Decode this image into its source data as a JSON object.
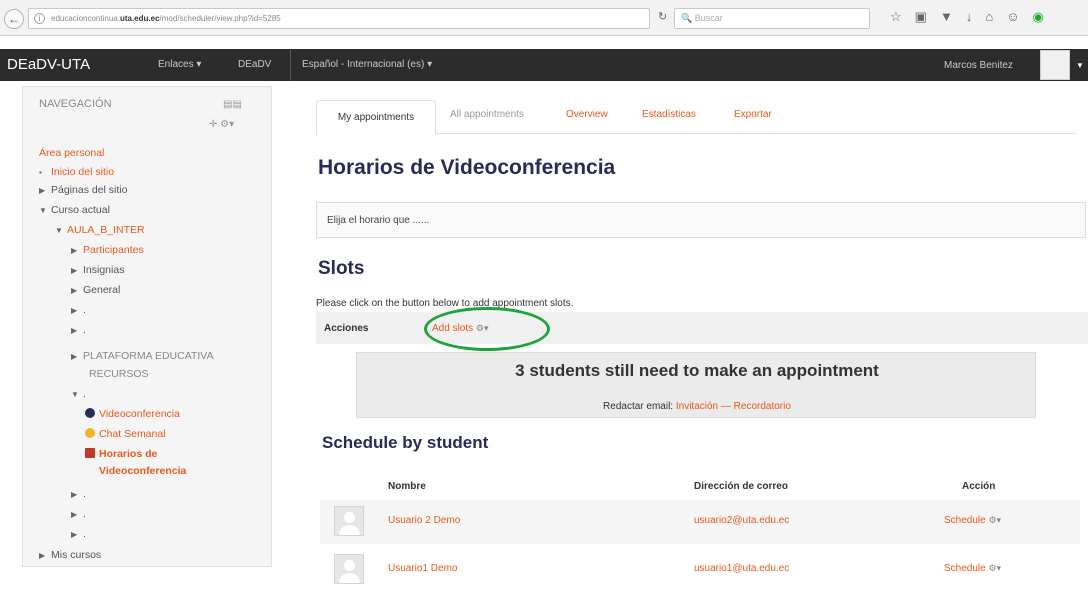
{
  "browser": {
    "url_prefix": "educacioncontinua.",
    "url_domain": "uta.edu.ec",
    "url_path": "/mod/scheduler/view.php?id=5285",
    "search_placeholder": "Buscar"
  },
  "navbar": {
    "brand": "DEaDV-UTA",
    "menu_links": "Enlaces ▾",
    "menu_deadv": "DEaDV",
    "menu_language": "Español - Internacional (es) ▾",
    "user_name": "Marcos Benitez"
  },
  "sidebar": {
    "title": "NAVEGACIÓN",
    "area_personal": "Área personal",
    "inicio": "Inicio del sitio",
    "paginas": "Páginas del sitio",
    "curso_actual": "Curso actual",
    "aula": "AULA_B_INTER",
    "participantes": "Participantes",
    "insignias": "Insignias",
    "general": "General",
    "dot1": ".",
    "dot2": ".",
    "plataforma_1": "PLATAFORMA EDUCATIVA",
    "plataforma_2": "RECURSOS",
    "dot3": ".",
    "videoconferencia": "Videoconferencia",
    "chat": "Chat Semanal",
    "horarios_1": "Horarios de",
    "horarios_2": "Videoconferencia",
    "dot4": ".",
    "dot5": ".",
    "dot6": ".",
    "mis_cursos": "Mis cursos"
  },
  "tabs": {
    "my_appointments": "My appointments",
    "all_appointments": "All appointments",
    "overview": "Overview",
    "estadisticas": "Estadísticas",
    "exportar": "Exportar"
  },
  "main": {
    "heading": "Horarios de Videoconferencia",
    "intro": "Elija el horario que ......",
    "slots_heading": "Slots",
    "slots_note": "Please click on the button below to add appointment slots.",
    "actions_label": "Acciones",
    "add_slots": "Add slots",
    "alert_title": "3 students still need to make an appointment",
    "mail_label": "Redactar email:",
    "mail_invite": "Invitación",
    "mail_sep": "—",
    "mail_reminder": "Recordatorio",
    "schedule_heading": "Schedule by student"
  },
  "table": {
    "headers": {
      "nombre": "Nombre",
      "correo": "Dirección de correo",
      "accion": "Acción"
    },
    "rows": [
      {
        "name": "Usuario 2 Demo",
        "email": "usuario2@uta.edu.ec",
        "action": "Schedule"
      },
      {
        "name": "Usuario1 Demo",
        "email": "usuario1@uta.edu.ec",
        "action": "Schedule"
      }
    ]
  },
  "colors": {
    "accent": "#e8591d",
    "heading": "#2a2a5a",
    "highlight": "#1fa33a",
    "navbar": "#2c2c2c"
  }
}
